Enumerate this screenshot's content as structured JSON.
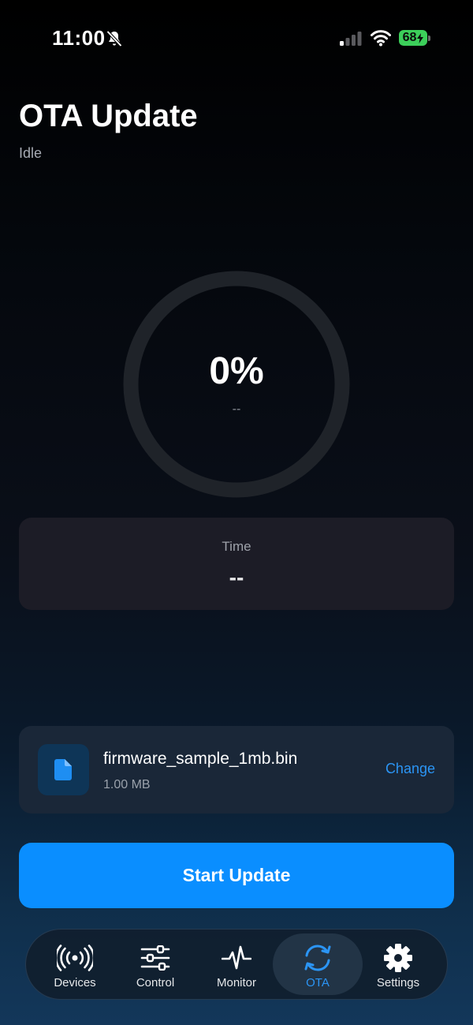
{
  "status_bar": {
    "time": "11:00",
    "battery": "68"
  },
  "header": {
    "title": "OTA Update",
    "status": "Idle"
  },
  "progress": {
    "percent_label": "0%",
    "percent_value": 0,
    "sub_label": "--"
  },
  "time_card": {
    "label": "Time",
    "value": "--"
  },
  "file": {
    "name": "firmware_sample_1mb.bin",
    "size": "1.00 MB",
    "change_label": "Change",
    "icon": "document-icon"
  },
  "start_button": {
    "label": "Start Update"
  },
  "tab_bar": {
    "active": "OTA",
    "items": [
      {
        "label": "Devices",
        "icon": "broadcast-icon"
      },
      {
        "label": "Control",
        "icon": "sliders-icon"
      },
      {
        "label": "Monitor",
        "icon": "pulse-icon"
      },
      {
        "label": "OTA",
        "icon": "sync-icon"
      },
      {
        "label": "Settings",
        "icon": "gear-icon"
      }
    ]
  },
  "colors": {
    "accent": "#0a8eff",
    "accent_text": "#2b95f5",
    "battery": "#3ccf5a"
  }
}
